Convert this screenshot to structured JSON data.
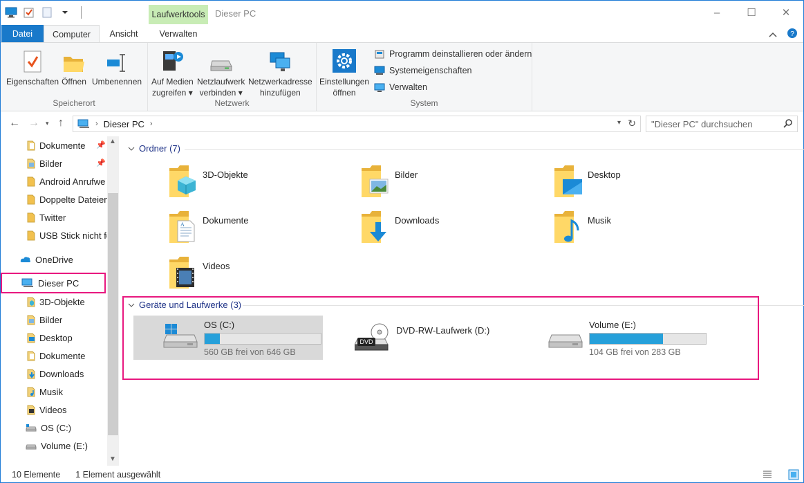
{
  "window": {
    "title": "Dieser PC",
    "context_tab": "Laufwerktools",
    "controls": [
      "–",
      "☐",
      "✕"
    ]
  },
  "tabs": {
    "file": "Datei",
    "computer": "Computer",
    "view": "Ansicht",
    "manage": "Verwalten"
  },
  "ribbon": {
    "location": {
      "label": "Speicherort",
      "properties": "Eigenschaften",
      "open": "Öffnen",
      "rename": "Umbenennen"
    },
    "network": {
      "label": "Netzwerk",
      "media_l1": "Auf Medien",
      "media_l2": "zugreifen",
      "map_l1": "Netzlaufwerk",
      "map_l2": "verbinden",
      "add_l1": "Netzwerkadresse",
      "add_l2": "hinzufügen"
    },
    "system": {
      "label": "System",
      "settings_l1": "Einstellungen",
      "settings_l2": "öffnen",
      "uninstall": "Programm deinstallieren oder ändern",
      "props": "Systemeigenschaften",
      "manage": "Verwalten"
    }
  },
  "address": {
    "path": "Dieser PC",
    "search_placeholder": "\"Dieser PC\" durchsuchen"
  },
  "sidebar": {
    "quick": [
      {
        "label": "Dokumente",
        "pinned": true
      },
      {
        "label": "Bilder",
        "pinned": true
      },
      {
        "label": "Android Anrufwe"
      },
      {
        "label": "Doppelte Dateien"
      },
      {
        "label": "Twitter"
      },
      {
        "label": "USB Stick nicht fo"
      }
    ],
    "onedrive": "OneDrive",
    "this_pc": "Dieser PC",
    "pc_items": [
      {
        "label": "3D-Objekte"
      },
      {
        "label": "Bilder"
      },
      {
        "label": "Desktop"
      },
      {
        "label": "Dokumente"
      },
      {
        "label": "Downloads"
      },
      {
        "label": "Musik"
      },
      {
        "label": "Videos"
      },
      {
        "label": "OS (C:)"
      },
      {
        "label": "Volume (E:)"
      }
    ]
  },
  "content": {
    "folders_header": "Ordner (7)",
    "folders": [
      {
        "name": "3D-Objekte",
        "icon": "3d-objects-folder-icon"
      },
      {
        "name": "Bilder",
        "icon": "pictures-folder-icon"
      },
      {
        "name": "Desktop",
        "icon": "desktop-folder-icon"
      },
      {
        "name": "Dokumente",
        "icon": "documents-folder-icon"
      },
      {
        "name": "Downloads",
        "icon": "downloads-folder-icon"
      },
      {
        "name": "Musik",
        "icon": "music-folder-icon"
      },
      {
        "name": "Videos",
        "icon": "videos-folder-icon"
      }
    ],
    "drives_header": "Geräte und Laufwerke (3)",
    "drives": [
      {
        "name": "OS (C:)",
        "free": "560 GB frei von 646 GB",
        "used_fraction": 0.133
      },
      {
        "name": "DVD-RW-Laufwerk (D:)"
      },
      {
        "name": "Volume (E:)",
        "free": "104 GB frei von 283 GB",
        "used_fraction": 0.632
      }
    ]
  },
  "status": {
    "count": "10 Elemente",
    "selected": "1 Element ausgewählt"
  },
  "colors": {
    "accent": "#1979ca",
    "highlight": "#e8187f",
    "bar_fill": "#26a0da",
    "context_tab": "#c8ecb5",
    "group_header": "#1e3287"
  }
}
